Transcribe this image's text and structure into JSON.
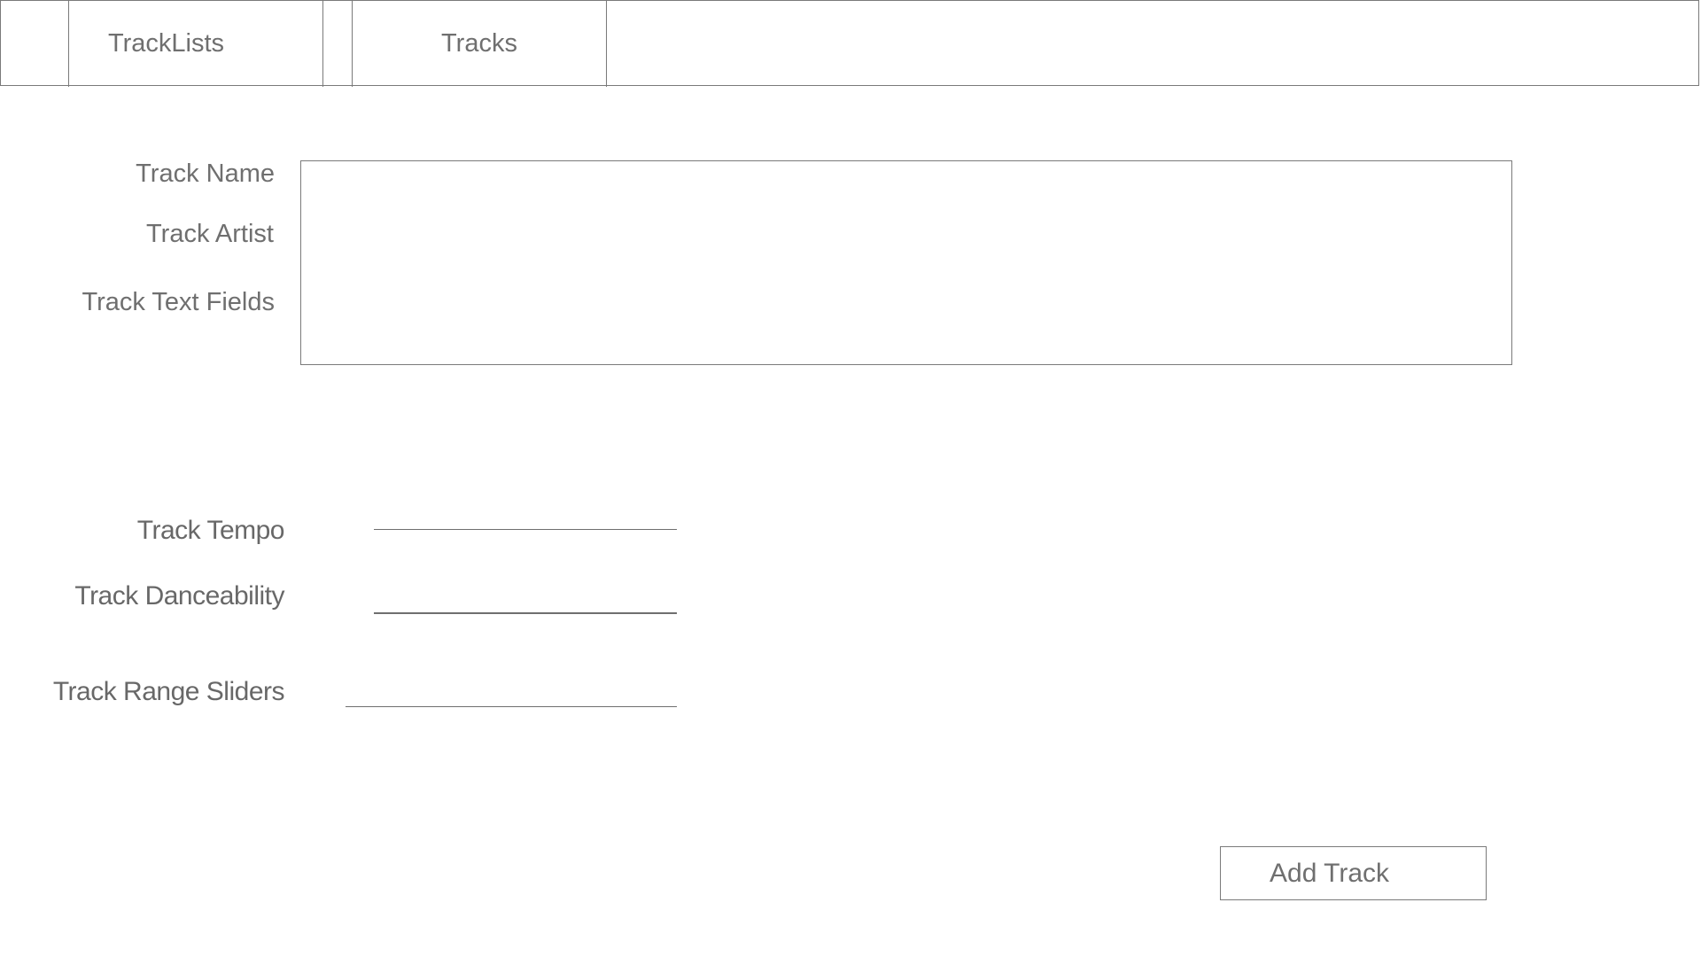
{
  "nav": {
    "tracklists_label": "TrackLists",
    "tracks_label": "Tracks"
  },
  "form": {
    "track_name_label": "Track Name",
    "track_artist_label": "Track Artist",
    "track_text_fields_label": "Track Text Fields",
    "track_tempo_label": "Track Tempo",
    "track_danceability_label": "Track Danceability",
    "track_range_sliders_label": "Track Range Sliders"
  },
  "actions": {
    "add_track_label": "Add Track"
  },
  "colors": {
    "border": "#7a7a7a",
    "text": "#6f6f6f",
    "background": "#ffffff"
  }
}
